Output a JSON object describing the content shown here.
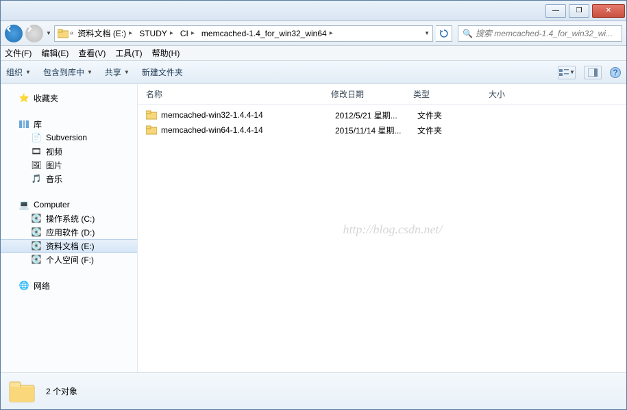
{
  "window_controls": {
    "min": "—",
    "max": "❐",
    "close": "✕"
  },
  "breadcrumb": {
    "segments": [
      "资料文档 (E:)",
      "STUDY",
      "CI",
      "memcached-1.4_for_win32_win64"
    ]
  },
  "search": {
    "placeholder": "搜索 memcached-1.4_for_win32_wi..."
  },
  "menubar": {
    "file": "文件(F)",
    "edit": "编辑(E)",
    "view": "查看(V)",
    "tools": "工具(T)",
    "help": "帮助(H)"
  },
  "toolbar": {
    "organize": "组织",
    "include": "包含到库中",
    "share": "共享",
    "newfolder": "新建文件夹"
  },
  "columns": {
    "name": "名称",
    "date": "修改日期",
    "type": "类型",
    "size": "大小"
  },
  "rows": [
    {
      "name": "memcached-win32-1.4.4-14",
      "date": "2012/5/21 星期...",
      "type": "文件夹"
    },
    {
      "name": "memcached-win64-1.4.4-14",
      "date": "2015/11/14 星期...",
      "type": "文件夹"
    }
  ],
  "sidebar": {
    "favorites": "收藏夹",
    "libraries": "库",
    "lib_items": [
      "Subversion",
      "视频",
      "图片",
      "音乐"
    ],
    "computer": "Computer",
    "drives": [
      "操作系统 (C:)",
      "应用软件 (D:)",
      "资料文档 (E:)",
      "个人空间 (F:)"
    ],
    "network": "网络"
  },
  "status": {
    "count": "2 个对象"
  },
  "watermark": "http://blog.csdn.net/"
}
